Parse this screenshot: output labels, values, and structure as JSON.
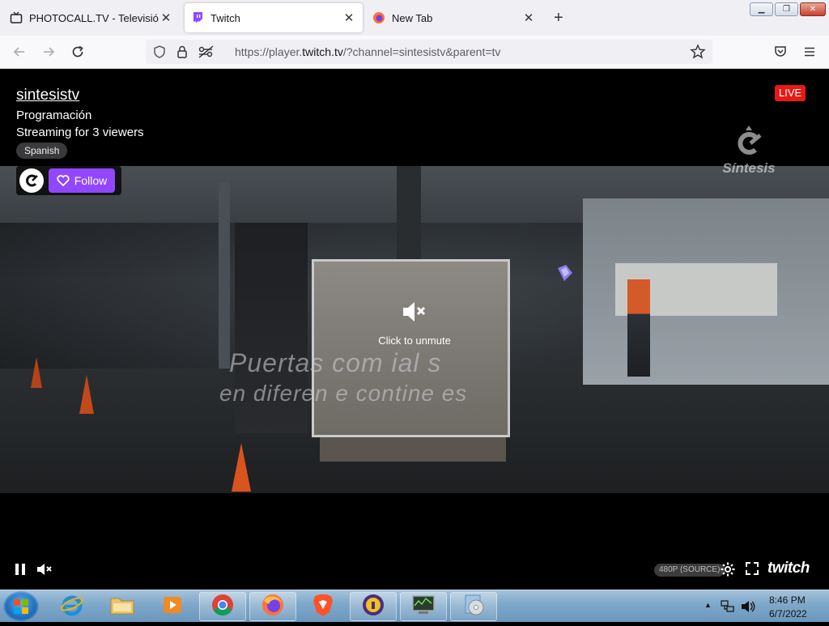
{
  "browser": {
    "tabs": [
      {
        "title": "PHOTOCALL.TV - Televisión y ra",
        "icon": "tv-icon",
        "active": false
      },
      {
        "title": "Twitch",
        "icon": "twitch-icon",
        "active": true
      },
      {
        "title": "New Tab",
        "icon": "firefox-icon",
        "active": false
      }
    ],
    "url_prefix": "https://player.",
    "url_domain": "twitch.tv",
    "url_suffix": "/?channel=sintesistv&parent=tv"
  },
  "player": {
    "channel_name": "sintesistv",
    "category": "Programación",
    "viewers_text": "Streaming for 3 viewers",
    "language_tag": "Spanish",
    "live_label": "LIVE",
    "follow_label": "Follow",
    "watermark_text": "Síntesis",
    "unmute_label": "Click to unmute",
    "subtitle_line1": "Puertas com    ial   s",
    "subtitle_line2": "en diferen  e   contine   es",
    "quality_label": "480P (SOURCE)",
    "logo_text": "twitch",
    "accent_color": "#9147ff",
    "live_color": "#e91916"
  },
  "taskbar": {
    "clock_time": "8:46 PM",
    "clock_date": "6/7/2022"
  }
}
